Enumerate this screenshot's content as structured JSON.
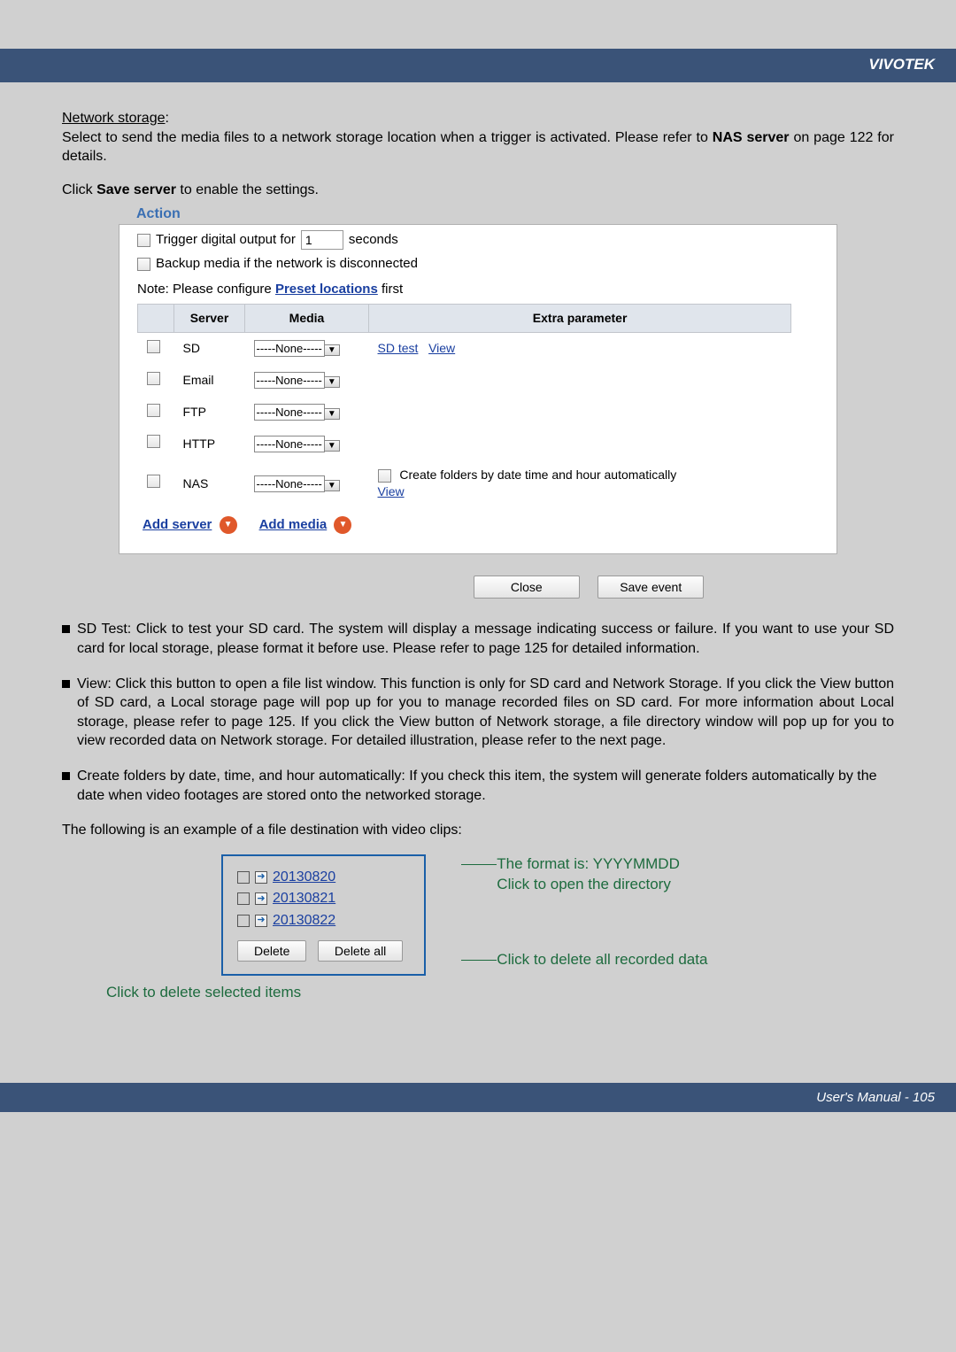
{
  "brand": "VIVOTEK",
  "intro": {
    "title": "Network storage",
    "line1_a": "Select to send the media files to a network storage location when a trigger is activated. Please refer to ",
    "line1_b": "NAS server",
    "line1_c": " on page 122 for details.",
    "line2_a": "Click ",
    "line2_b": "Save server",
    "line2_c": " to enable the settings."
  },
  "panel": {
    "legend": "Action",
    "trigger_a": "Trigger digital output for",
    "trigger_value": "1",
    "trigger_b": "seconds",
    "backup": "Backup media if the network is disconnected",
    "note_a": "Note: Please configure ",
    "note_link": "Preset locations",
    "note_b": " first",
    "headers": {
      "server": "Server",
      "media": "Media",
      "extra": "Extra parameter"
    },
    "none": "-----None-----",
    "rows": {
      "sd": "SD",
      "email": "Email",
      "ftp": "FTP",
      "http": "HTTP",
      "nas": "NAS"
    },
    "sd_test": "SD test",
    "view": "View",
    "nas_create": "Create folders by date time and hour automatically",
    "add_server": "Add server",
    "add_media": "Add media"
  },
  "buttons": {
    "close": "Close",
    "save_event": "Save event"
  },
  "bullets": {
    "b1": "SD Test: Click to test your SD card. The system will display a message indicating success or failure. If you want to use your SD card for local storage, please format it before use. Please refer to page 125 for detailed information.",
    "b2": "View: Click this button to open a file list window. This function is only for SD card and Network Storage. If you click the View button of SD card, a Local storage page will pop up for you to manage recorded files on SD card. For more information about Local storage, please refer to page 125. If you click the View button of Network storage, a file directory window will pop up for you to view recorded data on Network storage. For detailed illustration, please refer to the next page.",
    "b3": "Create folders by date, time, and hour automatically: If you check this item, the system will generate folders automatically by the date when video footages are stored onto the networked storage."
  },
  "example_intro": "The following is an example of a file destination with video clips:",
  "folders": {
    "d1": "20130820",
    "d2": "20130821",
    "d3": "20130822"
  },
  "folder_btns": {
    "delete": "Delete",
    "delete_all": "Delete all"
  },
  "annotations": {
    "format": "The format is: YYYYMMDD",
    "open": "Click to open the directory",
    "del_all": "Click to delete all recorded data",
    "del_sel": "Click to delete selected items"
  },
  "footer": "User's Manual - 105"
}
